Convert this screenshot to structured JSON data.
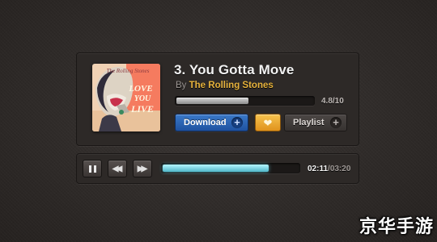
{
  "track": {
    "title": "3. You Gotta Move",
    "by_word": "By",
    "artist": "The Rolling Stones",
    "rating": {
      "value": 4.8,
      "max": 10,
      "label": "4.8/10"
    }
  },
  "album_art": {
    "icon": "album-cover-image",
    "caption": "LOVE YOU LIVE"
  },
  "actions": {
    "download_label": "Download",
    "download_icon": "plus-icon",
    "favorite_icon": "heart-icon",
    "playlist_label": "Playlist",
    "playlist_icon": "plus-icon"
  },
  "transport": {
    "pause_icon": "pause-icon",
    "rewind_icon": "rewind-icon",
    "forward_icon": "fast-forward-icon",
    "progress": 0.68,
    "time_current": "02:11",
    "time_separator": "/",
    "time_total": "03:20"
  },
  "watermark": {
    "text": "京华手游"
  },
  "colors": {
    "accent_artist": "#e6b23c",
    "download_blue": "#2a62b4",
    "favorite_orange": "#f0aa30",
    "progress_cyan": "#7fe3ef"
  }
}
